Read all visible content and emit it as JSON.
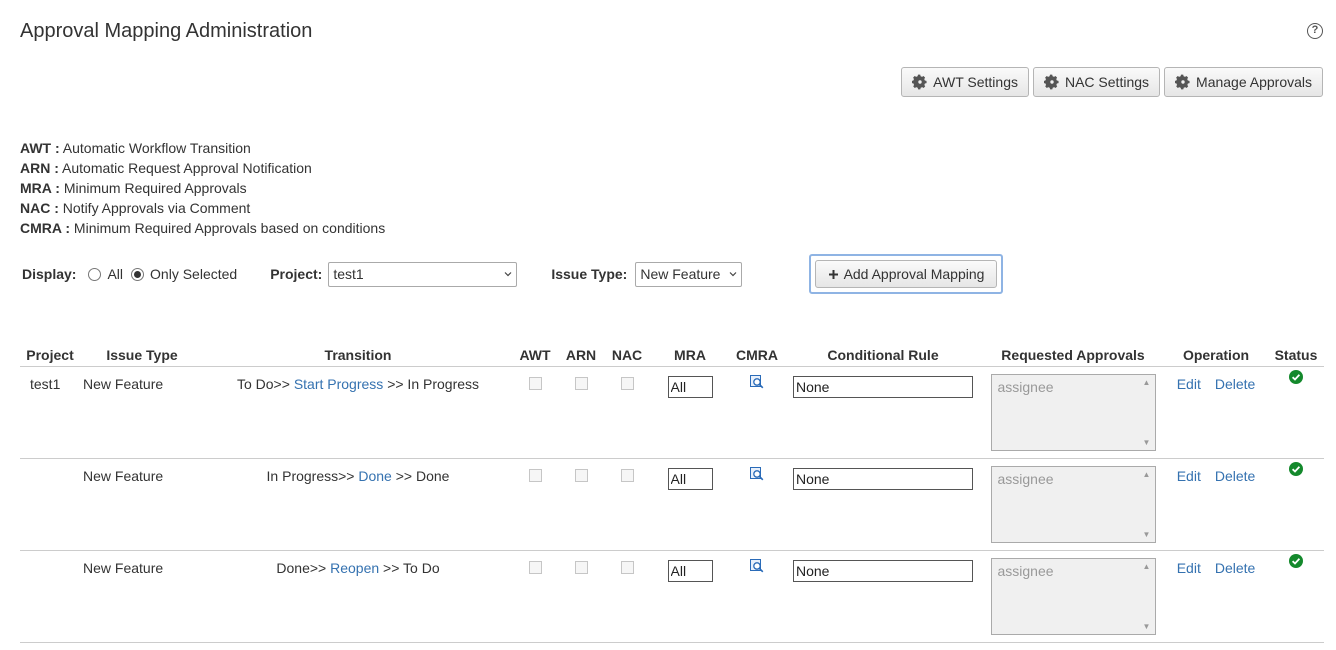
{
  "header": {
    "title": "Approval Mapping Administration",
    "help_glyph": "?"
  },
  "toolbar": {
    "awt_settings": "AWT Settings",
    "nac_settings": "NAC Settings",
    "manage_approvals": "Manage Approvals"
  },
  "legend": [
    {
      "abbr": "AWT :",
      "text": "Automatic Workflow Transition"
    },
    {
      "abbr": "ARN :",
      "text": "Automatic Request Approval Notification"
    },
    {
      "abbr": "MRA :",
      "text": "Minimum Required Approvals"
    },
    {
      "abbr": "NAC :",
      "text": "Notify Approvals via Comment"
    },
    {
      "abbr": "CMRA :",
      "text": "Minimum Required Approvals based on conditions"
    }
  ],
  "filters": {
    "display_label": "Display:",
    "display_all": "All",
    "display_selected": "Only Selected",
    "project_label": "Project:",
    "project_value": "test1",
    "issue_type_label": "Issue Type:",
    "issue_type_value": "New Feature",
    "add_button": "Add Approval Mapping"
  },
  "table": {
    "headers": {
      "project": "Project",
      "issue_type": "Issue Type",
      "transition": "Transition",
      "awt": "AWT",
      "arn": "ARN",
      "nac": "NAC",
      "mra": "MRA",
      "cmra": "CMRA",
      "conditional_rule": "Conditional Rule",
      "requested_approvals": "Requested Approvals",
      "operation": "Operation",
      "status": "Status"
    },
    "rows": [
      {
        "project": "test1",
        "issue_type": "New Feature",
        "from": "To Do>>",
        "action": "Start Progress",
        "to": ">> In Progress",
        "mra": "All",
        "rule": "None",
        "approvals": "assignee",
        "edit": "Edit",
        "delete": "Delete"
      },
      {
        "project": "",
        "issue_type": "New Feature",
        "from": "In Progress>>",
        "action": "Done",
        "to": ">> Done",
        "mra": "All",
        "rule": "None",
        "approvals": "assignee",
        "edit": "Edit",
        "delete": "Delete"
      },
      {
        "project": "",
        "issue_type": "New Feature",
        "from": "Done>>",
        "action": "Reopen",
        "to": ">> To Do",
        "mra": "All",
        "rule": "None",
        "approvals": "assignee",
        "edit": "Edit",
        "delete": "Delete"
      }
    ]
  },
  "icons": {
    "gear": "gear-icon",
    "plus": "plus-icon",
    "chevron": "chevron-down-icon",
    "cmra": "magnifier-icon",
    "status": "check-circle-icon",
    "status_color": "#14892c",
    "link_color": "#3572b0"
  }
}
